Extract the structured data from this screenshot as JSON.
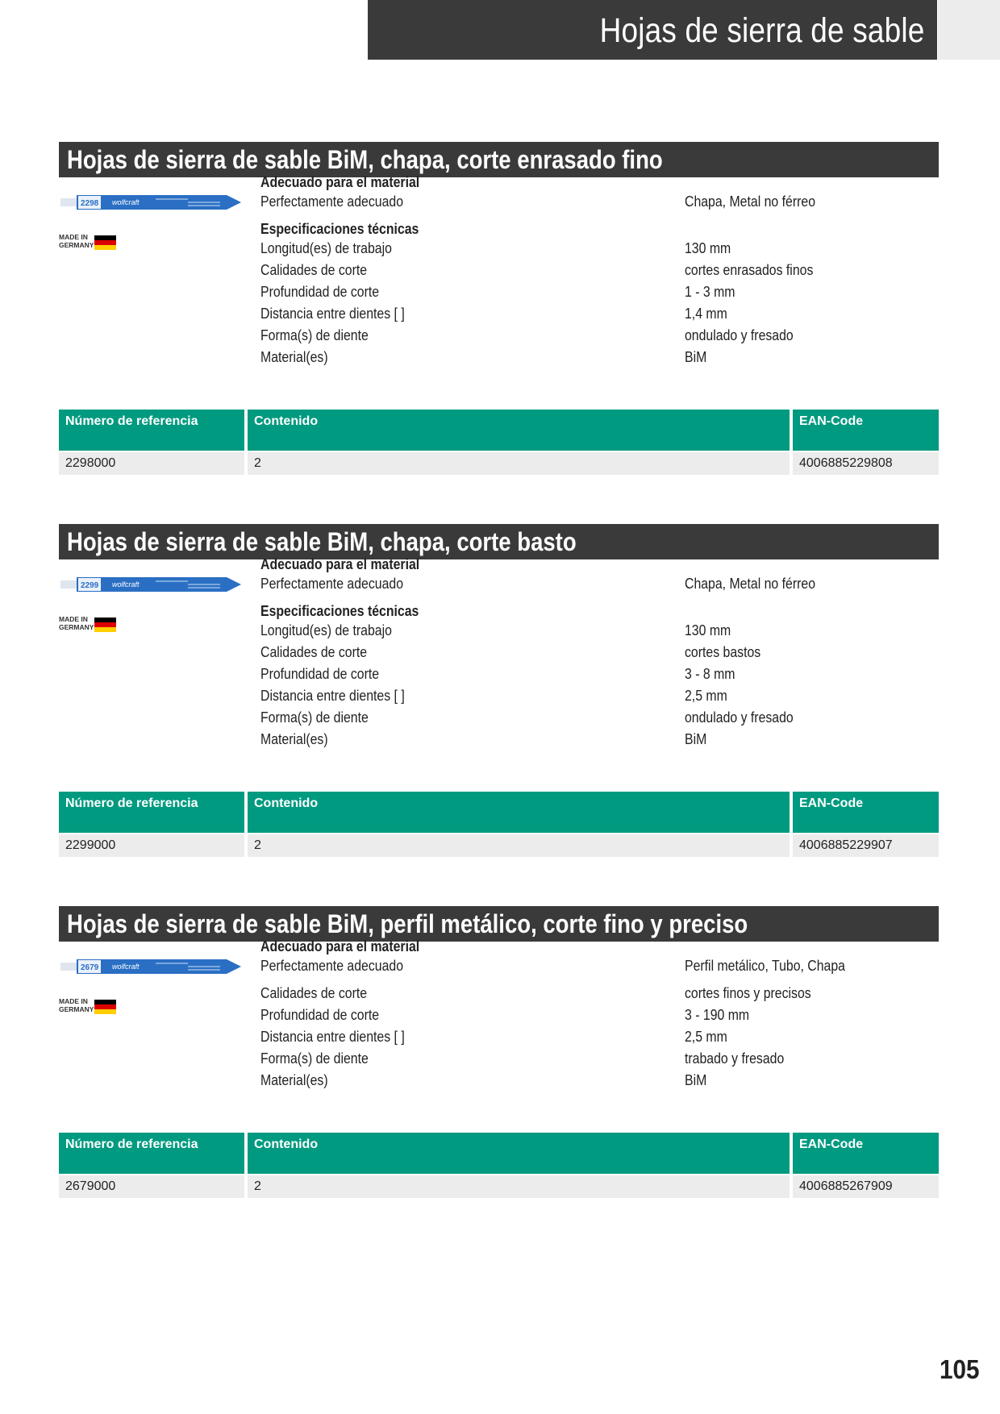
{
  "header": {
    "title": "Hojas de sierra de sable"
  },
  "labels": {
    "made_in": "MADE IN",
    "germany": "GERMANY",
    "suitable_heading": "Adecuado para el material",
    "suitable_label": "Perfectamente adecuado",
    "tech_heading": "Especificaciones técnicas",
    "col_ref": "Número de referencia",
    "col_content": "Contenido",
    "col_ean": "EAN-Code",
    "brand": "wolfcraft"
  },
  "sections": [
    {
      "title": "Hojas de sierra de sable BiM, chapa, corte enrasado fino",
      "blade_code": "2298",
      "suitable_value": "Chapa, Metal no férreo",
      "specs": [
        {
          "label": "Longitud(es) de trabajo",
          "value": "130 mm"
        },
        {
          "label": "Calidades de corte",
          "value": "cortes enrasados finos"
        },
        {
          "label": "Profundidad de corte",
          "value": "1 - 3 mm"
        },
        {
          "label": "Distancia entre dientes [ ]",
          "value": "1,4 mm"
        },
        {
          "label": "Forma(s) de diente",
          "value": "ondulado y fresado"
        },
        {
          "label": "Material(es)",
          "value": "BiM"
        }
      ],
      "row": {
        "ref": "2298000",
        "content": "2",
        "ean": "4006885229808"
      }
    },
    {
      "title": "Hojas de sierra de sable BiM, chapa, corte basto",
      "blade_code": "2299",
      "suitable_value": "Chapa, Metal no férreo",
      "specs": [
        {
          "label": "Longitud(es) de trabajo",
          "value": "130 mm"
        },
        {
          "label": "Calidades de corte",
          "value": "cortes bastos"
        },
        {
          "label": "Profundidad de corte",
          "value": "3 - 8 mm"
        },
        {
          "label": "Distancia entre dientes [ ]",
          "value": "2,5 mm"
        },
        {
          "label": "Forma(s) de diente",
          "value": "ondulado y fresado"
        },
        {
          "label": "Material(es)",
          "value": "BiM"
        }
      ],
      "row": {
        "ref": "2299000",
        "content": "2",
        "ean": "4006885229907"
      }
    },
    {
      "title": "Hojas de sierra de sable BiM, perfil metálico, corte fino y preciso",
      "blade_code": "2679",
      "suitable_value": "Perfil metálico, Tubo, Chapa",
      "specs": [
        {
          "label": "Calidades de corte",
          "value": "cortes finos y precisos"
        },
        {
          "label": "Profundidad de corte",
          "value": "3 - 190 mm"
        },
        {
          "label": "Distancia entre dientes [ ]",
          "value": "2,5 mm"
        },
        {
          "label": "Forma(s) de diente",
          "value": "trabado y fresado"
        },
        {
          "label": "Material(es)",
          "value": "BiM"
        }
      ],
      "row": {
        "ref": "2679000",
        "content": "2",
        "ean": "4006885267909"
      }
    }
  ],
  "page_number": "105",
  "colors": {
    "header_dark": "#3a3a3a",
    "table_green": "#009a80",
    "row_gray": "#ececec",
    "blade_blue": "#2a6fc4"
  }
}
